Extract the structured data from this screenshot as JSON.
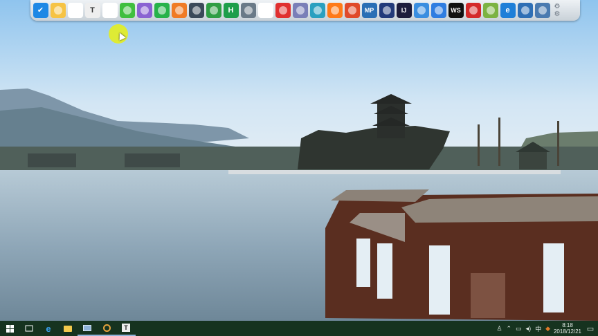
{
  "dock": {
    "icons": [
      {
        "name": "shield-security-icon",
        "glyph": "✔",
        "bg": "#1e88e5"
      },
      {
        "name": "folder-icon",
        "glyph": "",
        "bg": "#f6c344"
      },
      {
        "name": "chrome-icon",
        "glyph": "",
        "bg": "#ffffff"
      },
      {
        "name": "typora-icon",
        "glyph": "T",
        "bg": "#eeeeee"
      },
      {
        "name": "qq-penguin-icon",
        "glyph": "",
        "bg": "#ffffff"
      },
      {
        "name": "wechat-icon",
        "glyph": "",
        "bg": "#3fbf3f"
      },
      {
        "name": "colorful-app-icon",
        "glyph": "",
        "bg": "#8a63d2"
      },
      {
        "name": "eye-app-icon",
        "glyph": "",
        "bg": "#27b24a"
      },
      {
        "name": "orange-grid-icon",
        "glyph": "",
        "bg": "#f07b25"
      },
      {
        "name": "monitor-icon",
        "glyph": "",
        "bg": "#3b4a5a"
      },
      {
        "name": "leaf-app-icon",
        "glyph": "",
        "bg": "#2f9e44"
      },
      {
        "name": "h-app-icon",
        "glyph": "H",
        "bg": "#1e9e4a"
      },
      {
        "name": "video-window-icon",
        "glyph": "",
        "bg": "#6a7a88"
      },
      {
        "name": "chat-bubble-icon",
        "glyph": "",
        "bg": "#ffffff"
      },
      {
        "name": "red-stamp-icon",
        "glyph": "",
        "bg": "#e03030"
      },
      {
        "name": "feather-icon",
        "glyph": "",
        "bg": "#7a7fb8"
      },
      {
        "name": "square-app-icon",
        "glyph": "",
        "bg": "#2aa0c0"
      },
      {
        "name": "firefox-icon",
        "glyph": "",
        "bg": "#ff7a18"
      },
      {
        "name": "triangle-app-icon",
        "glyph": "",
        "bg": "#e04a2a"
      },
      {
        "name": "mp-app-icon",
        "glyph": "MP",
        "bg": "#2a6fb5"
      },
      {
        "name": "globe-app-icon",
        "glyph": "",
        "bg": "#223a7a"
      },
      {
        "name": "intellij-icon",
        "glyph": "IJ",
        "bg": "#1c1c3c"
      },
      {
        "name": "bird-app-icon",
        "glyph": "",
        "bg": "#3a8ee0"
      },
      {
        "name": "cloud-app-icon",
        "glyph": "",
        "bg": "#2f7de1"
      },
      {
        "name": "webstorm-icon",
        "glyph": "WS",
        "bg": "#111111"
      },
      {
        "name": "red-app-icon",
        "glyph": "",
        "bg": "#d42a2a"
      },
      {
        "name": "map-app-icon",
        "glyph": "",
        "bg": "#7cb342"
      },
      {
        "name": "ie-browser-icon",
        "glyph": "e",
        "bg": "#1e7fd8"
      },
      {
        "name": "desktop-icon",
        "glyph": "",
        "bg": "#2f6fb5"
      },
      {
        "name": "paint-app-icon",
        "glyph": "",
        "bg": "#4a7ab0"
      }
    ],
    "settings_icon": "gear-icon"
  },
  "taskbar": {
    "apps": [
      {
        "name": "start-windows-icon"
      },
      {
        "name": "task-view-icon"
      },
      {
        "name": "edge-browser-icon"
      },
      {
        "name": "file-explorer-icon"
      },
      {
        "name": "remote-desktop-icon"
      },
      {
        "name": "recording-app-icon"
      },
      {
        "name": "typora-taskbar-icon"
      }
    ],
    "tray": {
      "ime": "中",
      "time": "8:18",
      "date": "2018/12/21"
    }
  }
}
